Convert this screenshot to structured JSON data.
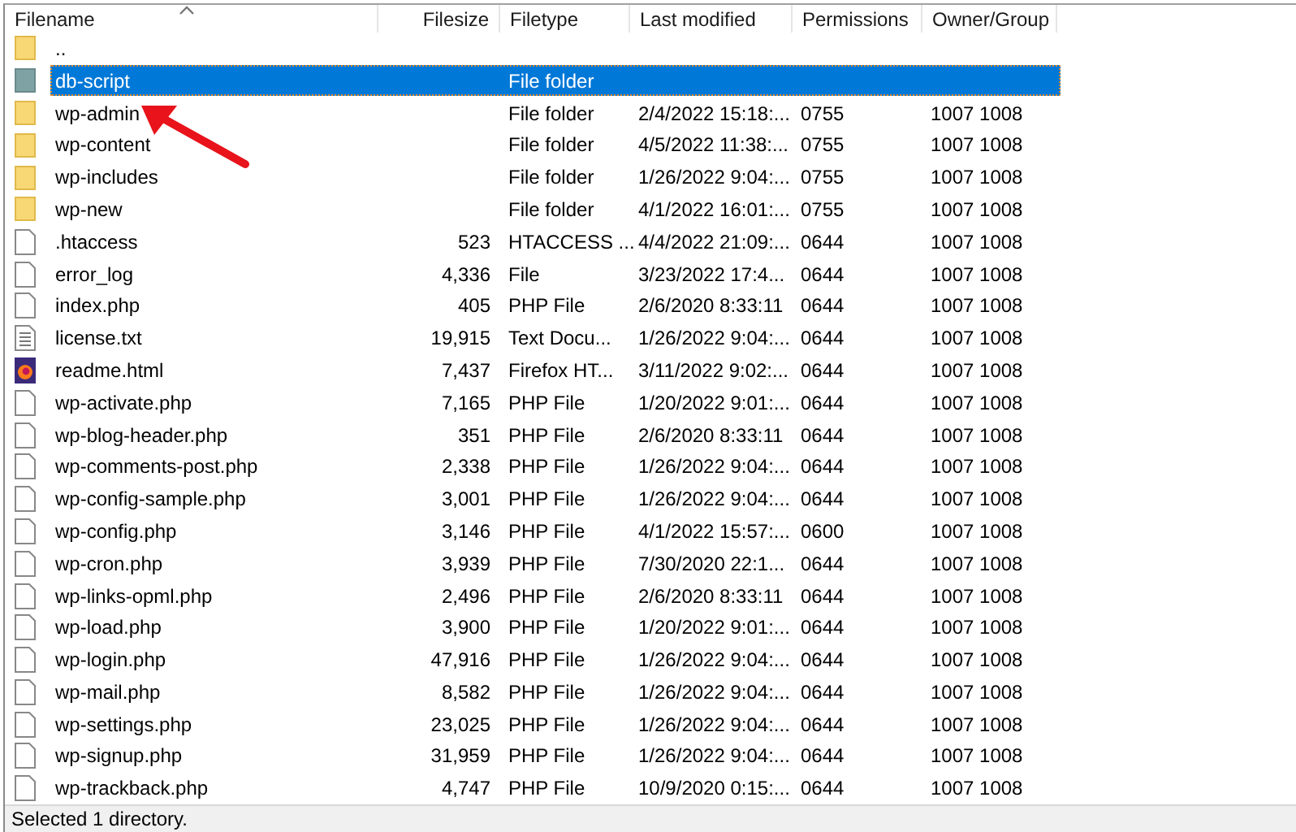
{
  "columns": [
    {
      "label": "Filename",
      "sorted": true
    },
    {
      "label": "Filesize",
      "sorted": false
    },
    {
      "label": "Filetype",
      "sorted": false
    },
    {
      "label": "Last modified",
      "sorted": false
    },
    {
      "label": "Permissions",
      "sorted": false
    },
    {
      "label": "Owner/Group",
      "sorted": false
    }
  ],
  "rows": [
    {
      "kind": "folder",
      "name": "..",
      "selected": false
    },
    {
      "kind": "folder",
      "name": "db-script",
      "type": "File folder",
      "selected": true
    },
    {
      "kind": "folder",
      "name": "wp-admin",
      "type": "File folder",
      "modified": "2/4/2022 15:18:...",
      "permissions": "0755",
      "owner": "1007 1008",
      "selected": false
    },
    {
      "kind": "folder",
      "name": "wp-content",
      "type": "File folder",
      "modified": "4/5/2022 11:38:...",
      "permissions": "0755",
      "owner": "1007 1008",
      "selected": false
    },
    {
      "kind": "folder",
      "name": "wp-includes",
      "type": "File folder",
      "modified": "1/26/2022 9:04:...",
      "permissions": "0755",
      "owner": "1007 1008",
      "selected": false
    },
    {
      "kind": "folder",
      "name": "wp-new",
      "type": "File folder",
      "modified": "4/1/2022 16:01:...",
      "permissions": "0755",
      "owner": "1007 1008",
      "selected": false
    },
    {
      "kind": "file",
      "name": ".htaccess",
      "size": "523",
      "type": "HTACCESS ...",
      "modified": "4/4/2022 21:09:...",
      "permissions": "0644",
      "owner": "1007 1008",
      "selected": false
    },
    {
      "kind": "file",
      "name": "error_log",
      "size": "4,336",
      "type": "File",
      "modified": "3/23/2022 17:4...",
      "permissions": "0644",
      "owner": "1007 1008",
      "selected": false
    },
    {
      "kind": "file",
      "name": "index.php",
      "size": "405",
      "type": "PHP File",
      "modified": "2/6/2020 8:33:11",
      "permissions": "0644",
      "owner": "1007 1008",
      "selected": false
    },
    {
      "kind": "text",
      "name": "license.txt",
      "size": "19,915",
      "type": "Text Docu...",
      "modified": "1/26/2022 9:04:...",
      "permissions": "0644",
      "owner": "1007 1008",
      "selected": false
    },
    {
      "kind": "browser",
      "name": "readme.html",
      "size": "7,437",
      "type": "Firefox HT...",
      "modified": "3/11/2022 9:02:...",
      "permissions": "0644",
      "owner": "1007 1008",
      "selected": false
    },
    {
      "kind": "file",
      "name": "wp-activate.php",
      "size": "7,165",
      "type": "PHP File",
      "modified": "1/20/2022 9:01:...",
      "permissions": "0644",
      "owner": "1007 1008",
      "selected": false
    },
    {
      "kind": "file",
      "name": "wp-blog-header.php",
      "size": "351",
      "type": "PHP File",
      "modified": "2/6/2020 8:33:11",
      "permissions": "0644",
      "owner": "1007 1008",
      "selected": false
    },
    {
      "kind": "file",
      "name": "wp-comments-post.php",
      "size": "2,338",
      "type": "PHP File",
      "modified": "1/26/2022 9:04:...",
      "permissions": "0644",
      "owner": "1007 1008",
      "selected": false
    },
    {
      "kind": "file",
      "name": "wp-config-sample.php",
      "size": "3,001",
      "type": "PHP File",
      "modified": "1/26/2022 9:04:...",
      "permissions": "0644",
      "owner": "1007 1008",
      "selected": false
    },
    {
      "kind": "file",
      "name": "wp-config.php",
      "size": "3,146",
      "type": "PHP File",
      "modified": "4/1/2022 15:57:...",
      "permissions": "0600",
      "owner": "1007 1008",
      "selected": false
    },
    {
      "kind": "file",
      "name": "wp-cron.php",
      "size": "3,939",
      "type": "PHP File",
      "modified": "7/30/2020 22:1...",
      "permissions": "0644",
      "owner": "1007 1008",
      "selected": false
    },
    {
      "kind": "file",
      "name": "wp-links-opml.php",
      "size": "2,496",
      "type": "PHP File",
      "modified": "2/6/2020 8:33:11",
      "permissions": "0644",
      "owner": "1007 1008",
      "selected": false
    },
    {
      "kind": "file",
      "name": "wp-load.php",
      "size": "3,900",
      "type": "PHP File",
      "modified": "1/20/2022 9:01:...",
      "permissions": "0644",
      "owner": "1007 1008",
      "selected": false
    },
    {
      "kind": "file",
      "name": "wp-login.php",
      "size": "47,916",
      "type": "PHP File",
      "modified": "1/26/2022 9:04:...",
      "permissions": "0644",
      "owner": "1007 1008",
      "selected": false
    },
    {
      "kind": "file",
      "name": "wp-mail.php",
      "size": "8,582",
      "type": "PHP File",
      "modified": "1/26/2022 9:04:...",
      "permissions": "0644",
      "owner": "1007 1008",
      "selected": false
    },
    {
      "kind": "file",
      "name": "wp-settings.php",
      "size": "23,025",
      "type": "PHP File",
      "modified": "1/26/2022 9:04:...",
      "permissions": "0644",
      "owner": "1007 1008",
      "selected": false
    },
    {
      "kind": "file",
      "name": "wp-signup.php",
      "size": "31,959",
      "type": "PHP File",
      "modified": "1/26/2022 9:04:...",
      "permissions": "0644",
      "owner": "1007 1008",
      "selected": false
    },
    {
      "kind": "file",
      "name": "wp-trackback.php",
      "size": "4,747",
      "type": "PHP File",
      "modified": "10/9/2020 0:15:...",
      "permissions": "0644",
      "owner": "1007 1008",
      "selected": false
    }
  ],
  "status_bar": "Selected 1 directory."
}
